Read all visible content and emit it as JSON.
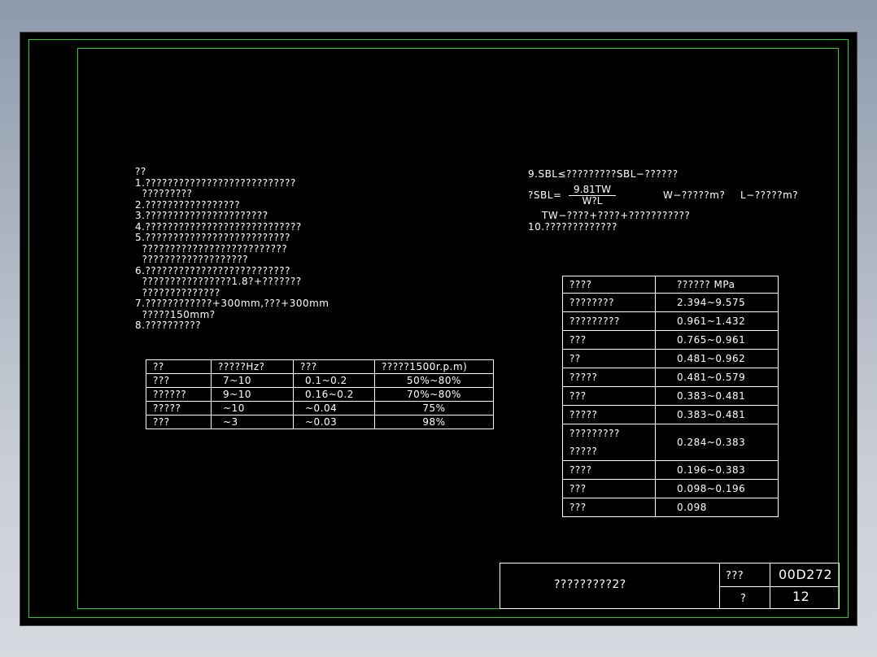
{
  "notes_left": {
    "heading": "??",
    "lines": [
      "1.???????????????????????????",
      "  ?????????",
      "2.?????????????????",
      "3.??????????????????????",
      "4.????????????????????????????",
      "5.??????????????????????????",
      "  ??????????????????????????",
      "  ???????????????????",
      "6.??????????????????????????",
      "  ????????????????1.8?+???????",
      "  ??????????????",
      "7.????????????+300mm,???+300mm",
      "  ?????150mm?",
      "8.??????????"
    ]
  },
  "notes_right": {
    "line9": "9.SBL≤?????????SBL−??????",
    "formula_prefix": "?SBL=",
    "formula_numerator": "9.81TW",
    "formula_denominator": "W?L",
    "formula_w": "W−?????m?",
    "formula_l": "L−?????m?",
    "formula_tw": "TW−????+????+???????????",
    "line10": "10.?????????????"
  },
  "left_table": {
    "headers": [
      "??",
      "?????Hz?",
      "???",
      "?????1500r.p.m)"
    ],
    "rows": [
      [
        "???",
        "7~10",
        "0.1~0.2",
        "50%~80%"
      ],
      [
        "??????",
        "9~10",
        "0.16~0.2",
        "70%~80%"
      ],
      [
        "?????",
        "~10",
        "~0.04",
        "75%"
      ],
      [
        "???",
        "~3",
        "~0.03",
        "98%"
      ]
    ]
  },
  "right_table": {
    "headers": [
      "????",
      "?????? MPa"
    ],
    "rows": [
      [
        "????????",
        "2.394~9.575"
      ],
      [
        "?????????",
        "0.961~1.432"
      ],
      [
        "???",
        "0.765~0.961"
      ],
      [
        "??",
        "0.481~0.962"
      ],
      [
        "?????",
        "0.481~0.579"
      ],
      [
        "???",
        "0.383~0.481"
      ],
      [
        "?????",
        "0.383~0.481"
      ],
      [
        "?????????\n?????",
        "0.284~0.383"
      ],
      [
        "????",
        "0.196~0.383"
      ],
      [
        "???",
        "0.098~0.196"
      ],
      [
        "???",
        "0.098"
      ]
    ]
  },
  "title_block": {
    "drawing_title": "?????????2?",
    "label_atlas": "???",
    "atlas_no": "00D272",
    "label_page": "?",
    "page_no": "12"
  },
  "colors": {
    "frame": "#19d619",
    "background": "#000000",
    "ink": "#ffffff"
  }
}
